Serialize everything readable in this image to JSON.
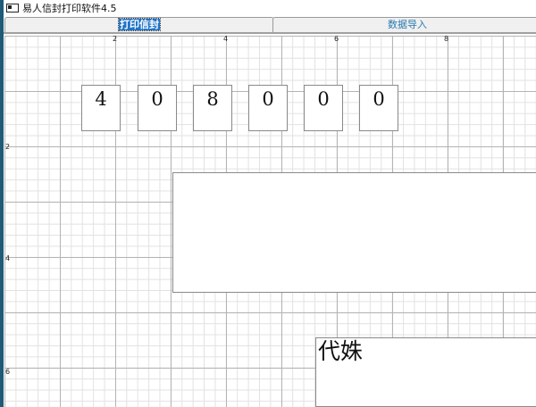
{
  "window": {
    "title": "易人信封打印软件4.5",
    "icon": "app-icon"
  },
  "tabs": [
    {
      "label": "打印信封",
      "active": true
    },
    {
      "label": "数据导入",
      "active": false
    }
  ],
  "ruler": {
    "x_ticks": [
      "2",
      "4",
      "6",
      "8"
    ],
    "y_ticks": [
      "2",
      "4",
      "6"
    ]
  },
  "envelope": {
    "postcode_digits": [
      "4",
      "0",
      "8",
      "0",
      "0",
      "0"
    ],
    "address": "",
    "recipient": "代姝"
  }
}
